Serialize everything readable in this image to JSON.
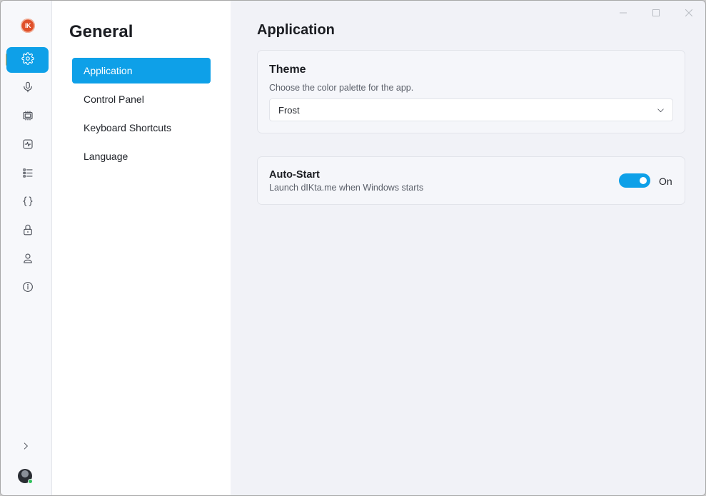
{
  "rail": {
    "logo_text": "IK",
    "items": [
      {
        "name": "settings",
        "icon": "gear-icon",
        "active": true
      },
      {
        "name": "microphone",
        "icon": "microphone-icon",
        "active": false
      },
      {
        "name": "processor",
        "icon": "chip-icon",
        "active": false
      },
      {
        "name": "activity",
        "icon": "activity-icon",
        "active": false
      },
      {
        "name": "list",
        "icon": "list-icon",
        "active": false
      },
      {
        "name": "code",
        "icon": "braces-icon",
        "active": false
      },
      {
        "name": "security",
        "icon": "lock-icon",
        "active": false
      },
      {
        "name": "account",
        "icon": "user-icon",
        "active": false
      },
      {
        "name": "about",
        "icon": "info-icon",
        "active": false
      }
    ],
    "expand_icon": "chevron-right-icon"
  },
  "subnav": {
    "title": "General",
    "items": [
      {
        "label": "Application",
        "active": true
      },
      {
        "label": "Control Panel",
        "active": false
      },
      {
        "label": "Keyboard Shortcuts",
        "active": false
      },
      {
        "label": "Language",
        "active": false
      }
    ]
  },
  "main": {
    "title": "Application",
    "theme": {
      "title": "Theme",
      "description": "Choose the color palette for the app.",
      "selected": "Frost"
    },
    "autostart": {
      "title": "Auto-Start",
      "description": "Launch dIKta.me when Windows starts",
      "state_label": "On",
      "enabled": true
    }
  },
  "colors": {
    "accent": "#0ea0e8",
    "indicator": "#f5a623",
    "logo": "#e0502a"
  }
}
